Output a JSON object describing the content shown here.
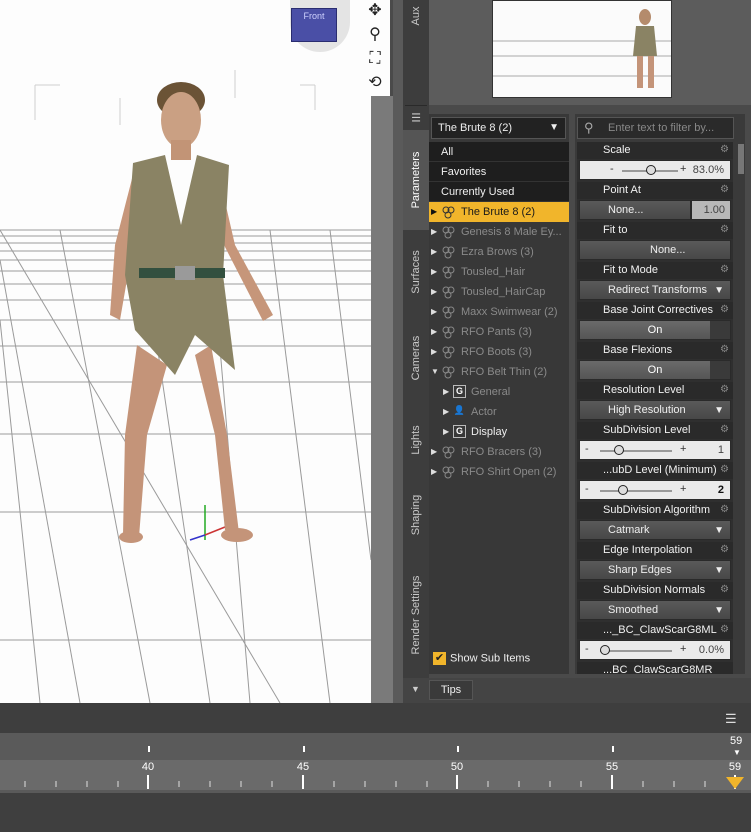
{
  "side_tabs": [
    "Aux",
    "Parameters",
    "Surfaces",
    "Cameras",
    "Lights",
    "Shaping",
    "Render Settings"
  ],
  "viewport": {
    "nav_cube_label": "Front"
  },
  "scene": {
    "figure_dropdown": "The Brute 8 (2)",
    "filters": [
      "All",
      "Favorites",
      "Currently Used"
    ],
    "tree": [
      {
        "label": "The Brute 8 (2)"
      },
      {
        "label": "Genesis 8 Male Ey..."
      },
      {
        "label": "Ezra Brows (3)"
      },
      {
        "label": "Tousled_Hair"
      },
      {
        "label": "Tousled_HairCap"
      },
      {
        "label": "Maxx Swimwear (2)"
      },
      {
        "label": "RFO Pants (3)"
      },
      {
        "label": "RFO Boots (3)"
      },
      {
        "label": "RFO Belt Thin (2)"
      },
      {
        "label": "General"
      },
      {
        "label": "Actor"
      },
      {
        "label": "Display"
      },
      {
        "label": "RFO Bracers (3)"
      },
      {
        "label": "RFO Shirt Open (2)"
      }
    ],
    "show_sub_items": "Show Sub Items"
  },
  "params": {
    "filter_placeholder": "Enter text to filter by...",
    "items": [
      {
        "name": "Scale",
        "value": "83.0%"
      },
      {
        "name": "Point At",
        "value": "None...",
        "num": "1.00"
      },
      {
        "name": "Fit to",
        "value": "None..."
      },
      {
        "name": "Fit to Mode",
        "value": "Redirect Transforms"
      },
      {
        "name": "Base Joint Correctives",
        "value": "On"
      },
      {
        "name": "Base Flexions",
        "value": "On"
      },
      {
        "name": "Resolution Level",
        "value": "High Resolution"
      },
      {
        "name": "SubDivision Level",
        "value": "1"
      },
      {
        "name": "...ubD Level (Minimum)",
        "value": "2"
      },
      {
        "name": "SubDivision Algorithm",
        "value": "Catmark"
      },
      {
        "name": "Edge Interpolation",
        "value": "Sharp Edges"
      },
      {
        "name": "SubDivision Normals",
        "value": "Smoothed"
      },
      {
        "name": "..._BC_ClawScarG8ML",
        "value": "0.0%"
      },
      {
        "name": "...BC_ClawScarG8MR",
        "value": ""
      }
    ]
  },
  "tips_label": "Tips",
  "timeline": {
    "ticks": [
      "40",
      "45",
      "50",
      "55",
      "59"
    ],
    "end_frame": "59"
  }
}
